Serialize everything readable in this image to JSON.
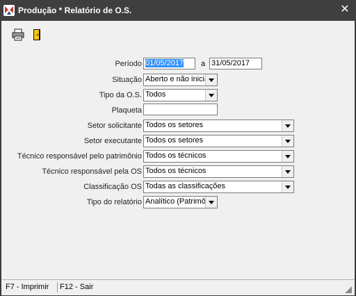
{
  "window": {
    "title": "Produção * Relatório de O.S."
  },
  "toolbar": {
    "print_icon": "printer-icon",
    "exit_icon": "exit-door-icon"
  },
  "form": {
    "periodo_label": "Período",
    "periodo_start": "01/05/2017",
    "periodo_sep": "a",
    "periodo_end": "31/05/2017",
    "situacao_label": "Situação",
    "situacao_value": "Aberto e não inicia",
    "tipo_os_label": "Tipo da O.S.",
    "tipo_os_value": "Todos",
    "plaqueta_label": "Plaqueta",
    "plaqueta_value": "",
    "setor_solicitante_label": "Setor solicitante",
    "setor_solicitante_value": "Todos os setores",
    "setor_executante_label": "Setor executante",
    "setor_executante_value": "Todos os setores",
    "tecnico_patrimonio_label": "Técnico responsável pelo patrimônio",
    "tecnico_patrimonio_value": "Todos os técnicos",
    "tecnico_os_label": "Técnico responsável pela OS",
    "tecnico_os_value": "Todos os técnicos",
    "classificacao_label": "Classificação OS",
    "classificacao_value": "Todas as classificações",
    "tipo_relatorio_label": "Tipo do relatório",
    "tipo_relatorio_value": "Analítico (Patrimôr"
  },
  "statusbar": {
    "f7": "F7 - Imprimir",
    "f12": "F12 - Sair"
  }
}
